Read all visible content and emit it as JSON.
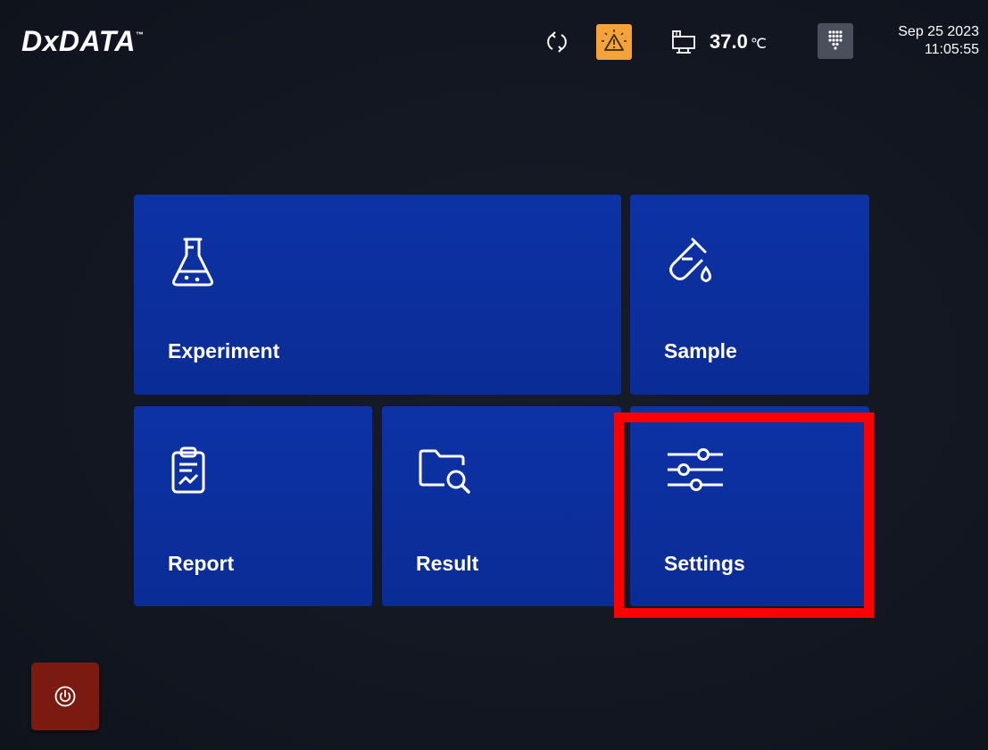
{
  "header": {
    "logo_text": "DxDATA",
    "logo_tm": "™",
    "temperature_value": "37.0",
    "temperature_unit": "℃",
    "date": "Sep 25 2023",
    "time": "11:05:55",
    "alert_color": "#f3a33a"
  },
  "tiles": [
    {
      "id": "experiment",
      "label": "Experiment",
      "icon": "flask-icon"
    },
    {
      "id": "sample",
      "label": "Sample",
      "icon": "test-tube-icon"
    },
    {
      "id": "report",
      "label": "Report",
      "icon": "clipboard-chart-icon"
    },
    {
      "id": "result",
      "label": "Result",
      "icon": "folder-search-icon"
    },
    {
      "id": "settings",
      "label": "Settings",
      "icon": "sliders-icon"
    }
  ],
  "highlight": {
    "target": "settings",
    "color": "#ff0000"
  },
  "footer": {
    "power_icon": "power-icon",
    "power_color": "#7a1a10"
  },
  "theme": {
    "tile_color": "#0d32a6",
    "background": "#131722"
  }
}
